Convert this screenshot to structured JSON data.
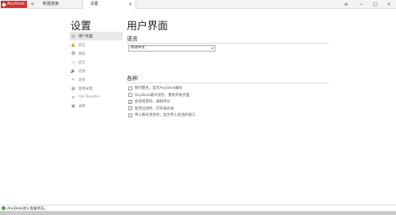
{
  "titlebar": {
    "app_name": "AnyDesk",
    "plus": "+",
    "tab_new": "新建连接",
    "tab_settings": "设置",
    "tab_close": "×",
    "menu": "≡",
    "minimize": "−",
    "maximize": "□",
    "close": "×"
  },
  "settings_heading": "设置",
  "nav": {
    "items": [
      {
        "label": "用户界面",
        "icon": "▤"
      },
      {
        "label": "安全",
        "icon": "🔒"
      },
      {
        "label": "隐私",
        "icon": "👁"
      },
      {
        "label": "显示",
        "icon": "▭"
      },
      {
        "label": "音频",
        "icon": "🔊"
      },
      {
        "label": "连接",
        "icon": "✎"
      },
      {
        "label": "图像采集",
        "icon": "▦"
      },
      {
        "label": "File Transfer",
        "icon": "⇄"
      },
      {
        "label": "录制",
        "icon": "▣"
      }
    ]
  },
  "main": {
    "title": "用户界面",
    "language_label": "语言",
    "language_value": "简体中文",
    "misc_label": "各种",
    "options": [
      {
        "label": "替代匿名，显示AnyDesk编号",
        "checked": false
      },
      {
        "label": "AnyDesk最大化时，重新开始页面",
        "checked": false
      },
      {
        "label": "会话结束时，通知评论",
        "checked": true
      },
      {
        "label": "程序启动时，打开通讯录",
        "checked": false
      },
      {
        "label": "传入聊天消息时，显示传入会话的窗口",
        "checked": false
      }
    ]
  },
  "status": {
    "text": "AnyDesk进入准备状态。"
  }
}
